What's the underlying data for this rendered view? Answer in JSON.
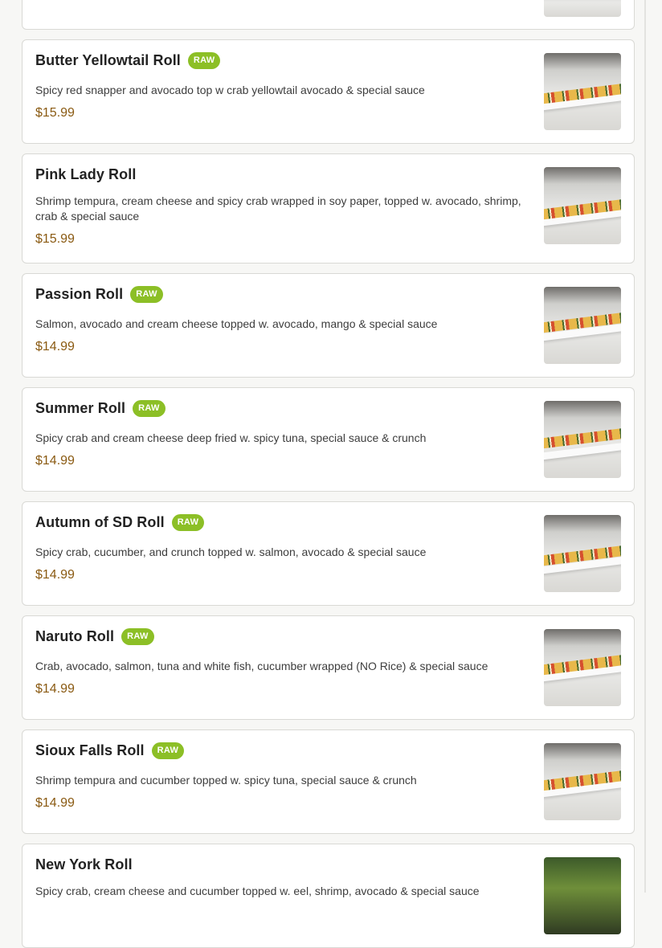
{
  "items": [
    {
      "name": "Butter Yellowtail Roll",
      "raw": "RAW",
      "description": "Spicy red snapper and avocado top w crab yellowtail avocado & special sauce",
      "price": "$15.99"
    },
    {
      "name": "Pink Lady Roll",
      "raw": "",
      "description": "Shrimp tempura, cream cheese and spicy crab wrapped in soy paper, topped w. avocado, shrimp, crab & special sauce",
      "price": "$15.99"
    },
    {
      "name": "Passion Roll",
      "raw": "RAW",
      "description": "Salmon, avocado and cream cheese topped w. avocado, mango & special sauce",
      "price": "$14.99"
    },
    {
      "name": "Summer Roll",
      "raw": "RAW",
      "description": "Spicy crab and cream cheese deep fried w. spicy tuna, special sauce & crunch",
      "price": "$14.99"
    },
    {
      "name": "Autumn of SD Roll",
      "raw": "RAW",
      "description": "Spicy crab, cucumber, and crunch topped w. salmon, avocado & special sauce",
      "price": "$14.99"
    },
    {
      "name": "Naruto Roll",
      "raw": "RAW",
      "description": "Crab, avocado, salmon, tuna and white fish, cucumber wrapped (NO Rice) & special sauce",
      "price": "$14.99"
    },
    {
      "name": "Sioux Falls Roll",
      "raw": "RAW",
      "description": "Shrimp tempura and cucumber topped w. spicy tuna, special sauce & crunch",
      "price": "$14.99"
    },
    {
      "name": "New York Roll",
      "raw": "",
      "description": "Spicy crab, cream cheese and cucumber topped w. eel, shrimp, avocado & special sauce",
      "price": ""
    }
  ],
  "colors": {
    "raw_badge": "#8cbf26",
    "price": "#8a5a12",
    "card_border": "#d9d9d5"
  },
  "icons": {
    "thumbnail": "sushi-roll-photo"
  }
}
